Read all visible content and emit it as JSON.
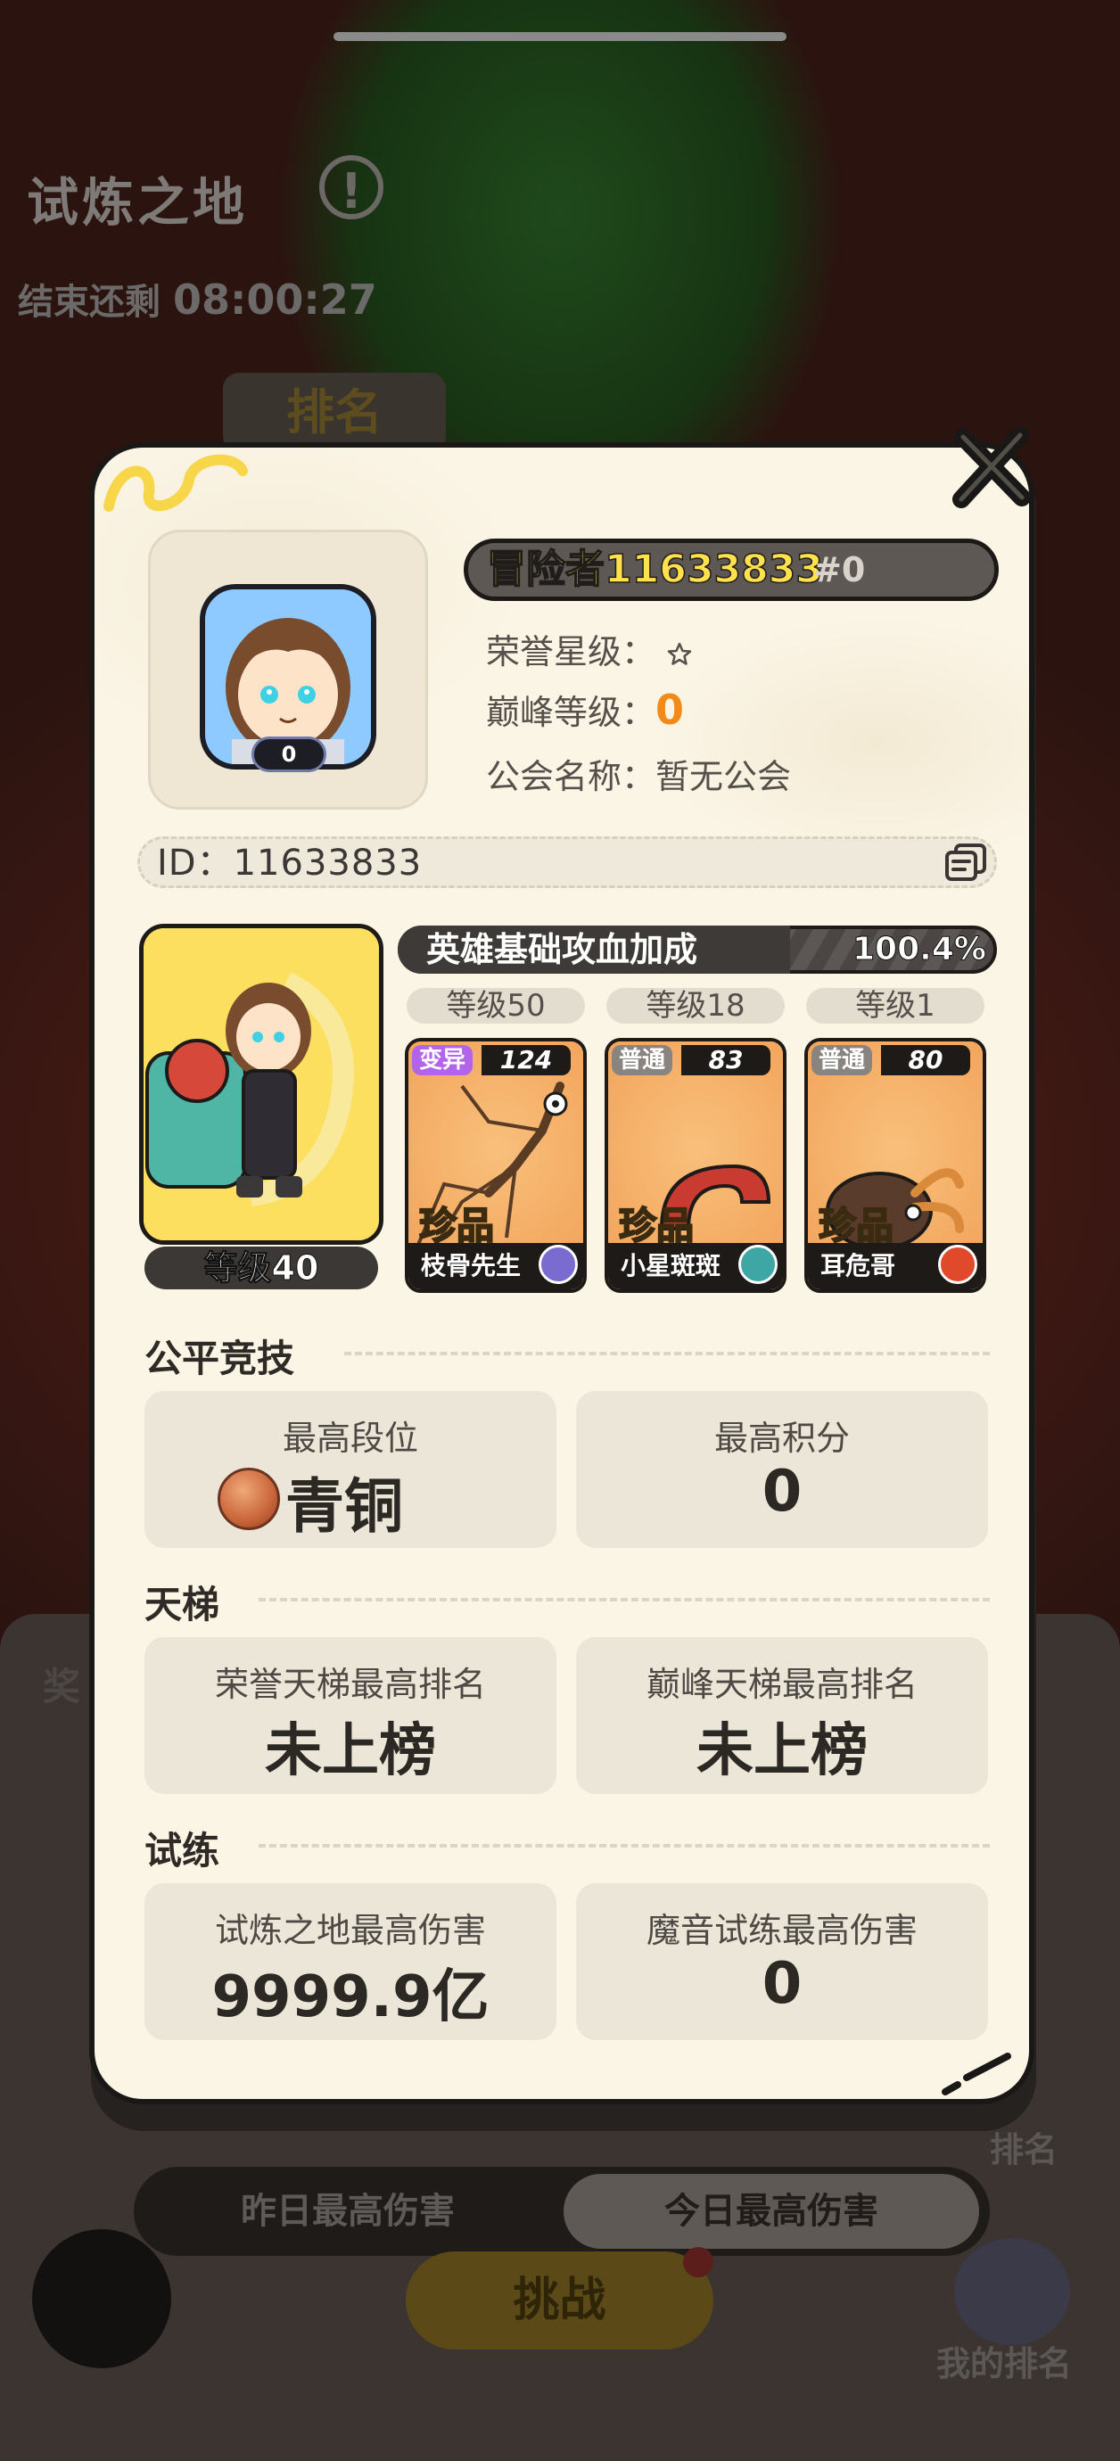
{
  "background": {
    "title": "试炼之地",
    "timer_prefix": "结束还剩",
    "timer_value": "08:00:27",
    "rank_tab": "排名",
    "reward_label": "奖",
    "side_rank": "排名",
    "my_rank": "我的排名",
    "tabs": [
      "昨日最高伤害",
      "今日最高伤害"
    ],
    "challenge_button": "挑战"
  },
  "profile": {
    "name": "冒险者11633833",
    "tag": "#0",
    "avatar_badge": "0",
    "honor_star_label": "荣誉星级：",
    "peak_level_label": "巅峰等级：",
    "peak_level_value": "0",
    "guild_label": "公会名称：",
    "guild_value": "暂无公会",
    "id_text": "ID：11633833"
  },
  "hero": {
    "level": "等级40",
    "bonus_label": "英雄基础攻血加成",
    "bonus_value": "100.4%"
  },
  "pets": [
    {
      "level": "等级50",
      "rarity": "变异",
      "power": "124",
      "grade": "珍品",
      "name": "枝骨先生",
      "element_color": "#7a6bd0"
    },
    {
      "level": "等级18",
      "rarity": "普通",
      "power": "83",
      "grade": "珍品",
      "name": "小星斑斑",
      "element_color": "#3fa6a6"
    },
    {
      "level": "等级1",
      "rarity": "普通",
      "power": "80",
      "grade": "珍品",
      "name": "耳危哥",
      "element_color": "#e04a2a"
    }
  ],
  "sections": {
    "fair": {
      "title": "公平竞技",
      "best_rank_label": "最高段位",
      "best_rank_value": "青铜",
      "best_score_label": "最高积分",
      "best_score_value": "0"
    },
    "ladder": {
      "title": "天梯",
      "honor_label": "荣誉天梯最高排名",
      "honor_value": "未上榜",
      "peak_label": "巅峰天梯最高排名",
      "peak_value": "未上榜"
    },
    "trial": {
      "title": "试练",
      "land_label": "试炼之地最高伤害",
      "land_value": "9999.9亿",
      "magic_label": "魔音试练最高伤害",
      "magic_value": "0"
    }
  },
  "colors": {
    "modal_bg": "#fbf5e6",
    "accent_orange": "#f28a1a",
    "name_yellow": "#ffe14d",
    "mutant_purple": "#b264ea"
  }
}
